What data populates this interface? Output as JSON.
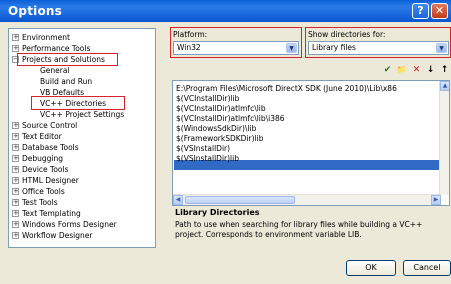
{
  "window": {
    "title": "Options",
    "help_glyph": "?",
    "close_glyph": "✕"
  },
  "tree": {
    "items": [
      {
        "label": "Environment",
        "expander": "+"
      },
      {
        "label": "Performance Tools",
        "expander": "+"
      },
      {
        "label": "Projects and Solutions",
        "expander": "−"
      },
      {
        "label": "General",
        "expander": ""
      },
      {
        "label": "Build and Run",
        "expander": ""
      },
      {
        "label": "VB Defaults",
        "expander": ""
      },
      {
        "label": "VC++ Directories",
        "expander": ""
      },
      {
        "label": "VC++ Project Settings",
        "expander": ""
      },
      {
        "label": "Source Control",
        "expander": "+"
      },
      {
        "label": "Text Editor",
        "expander": "+"
      },
      {
        "label": "Database Tools",
        "expander": "+"
      },
      {
        "label": "Debugging",
        "expander": "+"
      },
      {
        "label": "Device Tools",
        "expander": "+"
      },
      {
        "label": "HTML Designer",
        "expander": "+"
      },
      {
        "label": "Office Tools",
        "expander": "+"
      },
      {
        "label": "Test Tools",
        "expander": "+"
      },
      {
        "label": "Text Templating",
        "expander": "+"
      },
      {
        "label": "Windows Forms Designer",
        "expander": "+"
      },
      {
        "label": "Workflow Designer",
        "expander": "+"
      }
    ]
  },
  "platform": {
    "label": "Platform:",
    "value": "Win32"
  },
  "show_dirs": {
    "label": "Show directories for:",
    "value": "Library files"
  },
  "toolbar": {
    "check_glyph": "✔",
    "folder_glyph": "📁",
    "delete_glyph": "✕",
    "down_glyph": "↓",
    "up_glyph": "↑"
  },
  "directories": [
    "E:\\Program Files\\Microsoft DirectX SDK (June 2010)\\Lib\\x86",
    "$(VCInstallDir)lib",
    "$(VCInstallDir)atlmfc\\lib",
    "$(VCInstallDir)atlmfc\\lib\\i386",
    "$(WindowsSdkDir)\\lib",
    "$(FrameworkSDKDir)lib",
    "$(VSInstallDir)",
    "$(VSInstallDir)lib",
    ""
  ],
  "description": {
    "title": "Library Directories",
    "text": "Path to use when searching for library files while building a VC++ project. Corresponds to environment variable LIB."
  },
  "buttons": {
    "ok": "OK",
    "cancel": "Cancel"
  }
}
